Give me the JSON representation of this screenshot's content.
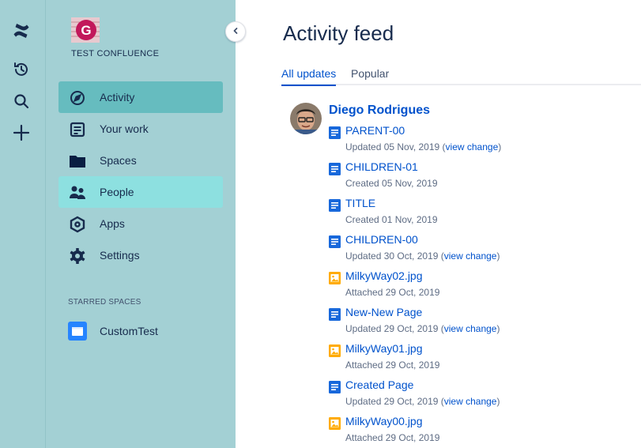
{
  "sidebar": {
    "space_name": "TEST CONFLUENCE",
    "space_logo_letter": "G",
    "nav": [
      {
        "label": "Activity",
        "icon": "compass-icon",
        "state": "active"
      },
      {
        "label": "Your work",
        "icon": "document-list-icon",
        "state": "normal"
      },
      {
        "label": "Spaces",
        "icon": "folder-icon",
        "state": "normal"
      },
      {
        "label": "People",
        "icon": "people-icon",
        "state": "hover"
      },
      {
        "label": "Apps",
        "icon": "apps-hexagon-icon",
        "state": "normal"
      },
      {
        "label": "Settings",
        "icon": "gear-icon",
        "state": "normal"
      }
    ],
    "starred_title": "STARRED SPACES",
    "starred": [
      {
        "label": "CustomTest",
        "icon": "space-icon"
      }
    ]
  },
  "rail": {
    "icons": [
      "confluence-logo-icon",
      "history-icon",
      "search-icon",
      "create-icon"
    ]
  },
  "main": {
    "title": "Activity feed",
    "tabs": [
      {
        "label": "All updates",
        "active": true
      },
      {
        "label": "Popular",
        "active": false
      }
    ],
    "author": "Diego Rodrigues",
    "items": [
      {
        "title": "PARENT-00",
        "type": "page",
        "meta": "Updated 05 Nov, 2019 (",
        "link": "view change",
        "meta_end": ")"
      },
      {
        "title": "CHILDREN-01",
        "type": "page",
        "meta": "Created 05 Nov, 2019",
        "link": "",
        "meta_end": ""
      },
      {
        "title": "TITLE",
        "type": "page",
        "meta": "Created 01 Nov, 2019",
        "link": "",
        "meta_end": ""
      },
      {
        "title": "CHILDREN-00",
        "type": "page",
        "meta": "Updated 30 Oct, 2019 (",
        "link": "view change",
        "meta_end": ")"
      },
      {
        "title": "MilkyWay02.jpg",
        "type": "image",
        "meta": "Attached 29 Oct, 2019",
        "link": "",
        "meta_end": ""
      },
      {
        "title": "New-New Page",
        "type": "page",
        "meta": "Updated 29 Oct, 2019 (",
        "link": "view change",
        "meta_end": ")"
      },
      {
        "title": "MilkyWay01.jpg",
        "type": "image",
        "meta": "Attached 29 Oct, 2019",
        "link": "",
        "meta_end": ""
      },
      {
        "title": "Created Page",
        "type": "page",
        "meta": "Updated 29 Oct, 2019 (",
        "link": "view change",
        "meta_end": ")"
      },
      {
        "title": "MilkyWay00.jpg",
        "type": "image",
        "meta": "Attached 29 Oct, 2019",
        "link": "",
        "meta_end": ""
      }
    ]
  },
  "colors": {
    "sidebar_bg": "#a3d0d4",
    "active_bg": "#66bcbf",
    "hover_bg": "#8de0e0",
    "link": "#0052cc",
    "page_icon": "#1868db",
    "image_icon": "#ffab00"
  }
}
